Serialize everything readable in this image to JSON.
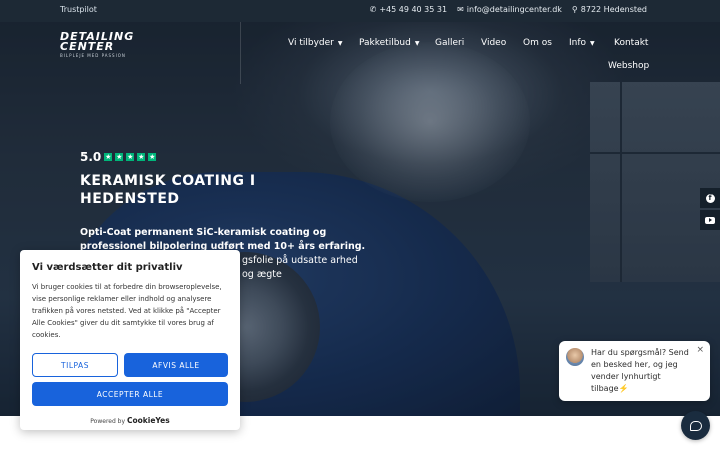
{
  "topbar": {
    "trustpilot": "Trustpilot",
    "phone": "+45 49 40 35 31",
    "email": "info@detailingcenter.dk",
    "location": "8722 Hedensted",
    "icons": [
      "phone-icon",
      "envelope-icon",
      "map-pin-icon"
    ]
  },
  "logo": {
    "line1": "DETAILING",
    "line2": "CENTER",
    "tagline": "BILPLEJE MED PASSION"
  },
  "nav": {
    "items": [
      {
        "label": "Vi tilbyder",
        "dropdown": true
      },
      {
        "label": "Pakketilbud",
        "dropdown": true
      },
      {
        "label": "Galleri",
        "dropdown": false
      },
      {
        "label": "Video",
        "dropdown": false
      },
      {
        "label": "Om os",
        "dropdown": false
      },
      {
        "label": "Info",
        "dropdown": true
      },
      {
        "label": "Kontakt",
        "dropdown": false
      },
      {
        "label": "Webshop",
        "dropdown": false
      }
    ]
  },
  "hero": {
    "rating_score": "5.0",
    "stars": 5,
    "title": "KERAMISK COATING I HEDENSTED",
    "text_bold": "Opti-Coat permanent SiC-keramisk coating og professionel bilpolering udført med 10+ års erfaring.",
    "text_partial": "gsfolie på udsatte arhed og ægte"
  },
  "social": [
    "facebook-icon",
    "youtube-icon"
  ],
  "cookie": {
    "title": "Vi værdsætter dit privatliv",
    "text": "Vi bruger cookies til at forbedre din browseroplevelse, vise personlige reklamer eller indhold og analysere trafikken på vores netsted. Ved at klikke på \"Accepter Alle Cookies\" giver du dit samtykke til vores brug af cookies.",
    "btn_customize": "TILPAS",
    "btn_reject": "AFVIS ALLE",
    "btn_accept": "ACCEPTER ALLE",
    "powered_prefix": "Powered by",
    "powered_brand": "CookieYes"
  },
  "chat": {
    "message": "Har du spørgsmål? Send en besked her, og jeg vender lynhurtigt tilbage⚡️",
    "close": "×"
  },
  "colors": {
    "topbar_bg": "#1d2935",
    "trustpilot_green": "#00b67a",
    "cookie_blue": "#1863dc",
    "chat_launcher": "#1a2c3f"
  }
}
